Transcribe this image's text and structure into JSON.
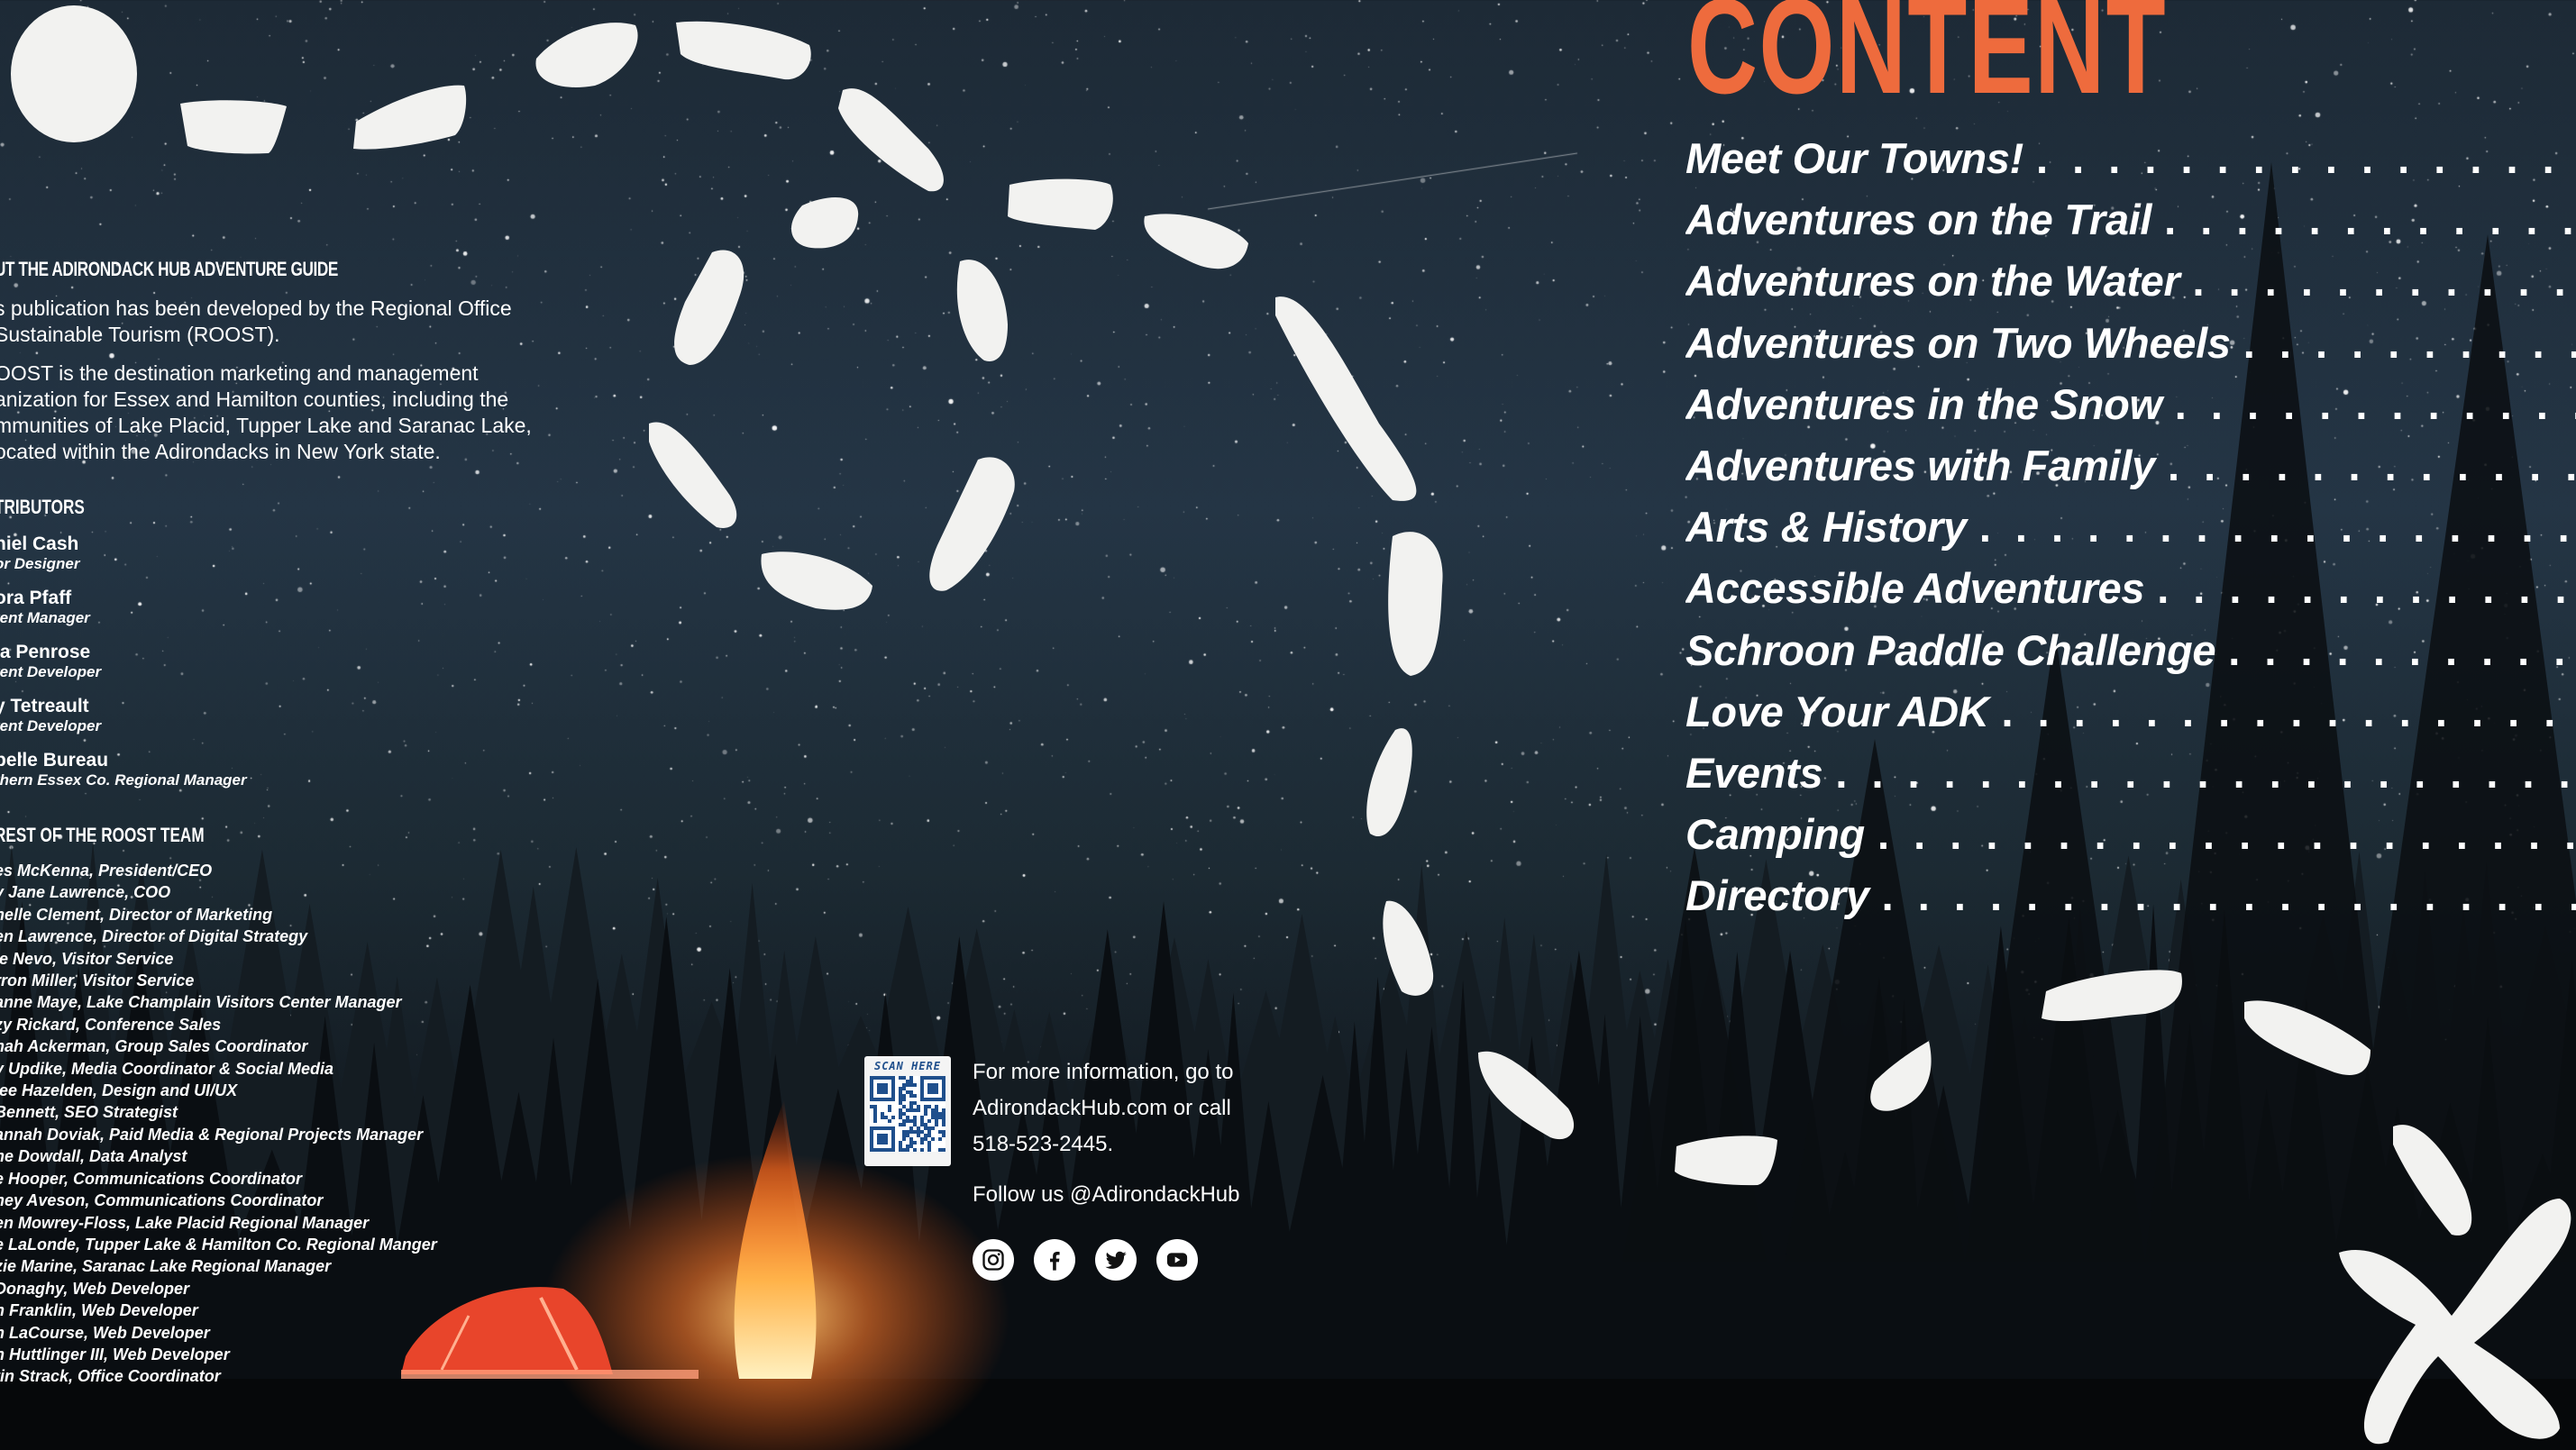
{
  "about": {
    "title": "UT THE ADIRONDACK HUB ADVENTURE GUIDE",
    "lines1": [
      "s publication has been developed by the Regional Office",
      "Sustainable Tourism (ROOST)."
    ],
    "lines2": [
      "OOST is the destination marketing and management",
      "anization for Essex and Hamilton counties, including the",
      "mmunities of Lake Placid, Tupper Lake and Saranac Lake,",
      "ocated within the Adirondacks in New York state."
    ]
  },
  "contributors": {
    "title": "TRIBUTORS",
    "people": [
      {
        "name": "niel Cash",
        "role": "or Designer"
      },
      {
        "name": "ora Pfaff",
        "role": "tent Manager"
      },
      {
        "name": "ia Penrose",
        "role": "tent Developer"
      },
      {
        "name": "y Tetreault",
        "role": "tent Developer"
      },
      {
        "name": "belle Bureau",
        "role": "thern Essex Co. Regional Manager"
      }
    ]
  },
  "team": {
    "title": "REST OF THE ROOST TEAM",
    "members": [
      "es McKenna, President/CEO",
      "y Jane Lawrence, COO",
      "helle Clement, Director of Marketing",
      "en Lawrence, Director of Digital Strategy",
      "ie Nevo, Visitor Service",
      "rron Miller, Visitor Service",
      "anne Maye, Lake Champlain Visitors Center Manager",
      "zy Rickard, Conference Sales",
      "nah Ackerman, Group Sales Coordinator",
      "y Updike, Media Coordinator & Social Media",
      "lee Hazelden, Design and UI/UX",
      "Bennett, SEO Strategist",
      "annah Doviak, Paid Media & Regional Projects Manager",
      "he Dowdall, Data Analyst",
      "e Hooper, Communications Coordinator",
      "ney Aveson, Communications Coordinator",
      "en Mowrey-Floss, Lake Placid Regional Manager",
      "e LaLonde, Tupper Lake & Hamilton Co. Regional Manger",
      "zie Marine, Saranac Lake Regional Manager",
      " Donaghy, Web Developer",
      "h Franklin, Web Developer",
      "n LaCourse, Web Developer",
      "n Huttlinger III, Web Developer",
      "tin Strack, Office Coordinator"
    ]
  },
  "qr": {
    "label": "SCAN HERE"
  },
  "info": {
    "line1": "For more information, go to",
    "line2": "AdirondackHub.com or call",
    "line3": "518-523-2445.",
    "follow": "Follow us @AdirondackHub"
  },
  "socials": [
    {
      "icon": "instagram-icon"
    },
    {
      "icon": "facebook-icon"
    },
    {
      "icon": "twitter-icon"
    },
    {
      "icon": "youtube-icon"
    }
  ],
  "toc": {
    "title": "CONTENT",
    "items": [
      "Meet Our Towns!",
      "Adventures on the Trail",
      "Adventures on the Water",
      "Adventures on Two Wheels",
      "Adventures in the Snow",
      "Adventures with Family",
      "Arts & History",
      "Accessible Adventures",
      "Schroon Paddle Challenge",
      "Love Your ADK",
      "Events",
      "Camping",
      "Directory"
    ],
    "leader": ". . . . . . . . . . . . . . . . . . . . . . . . . . . . . . . . . . . . . . . . . . . . ."
  },
  "colors": {
    "accent": "#ee6b3d",
    "trail": "#f2f2f0",
    "sky": "#243545"
  }
}
